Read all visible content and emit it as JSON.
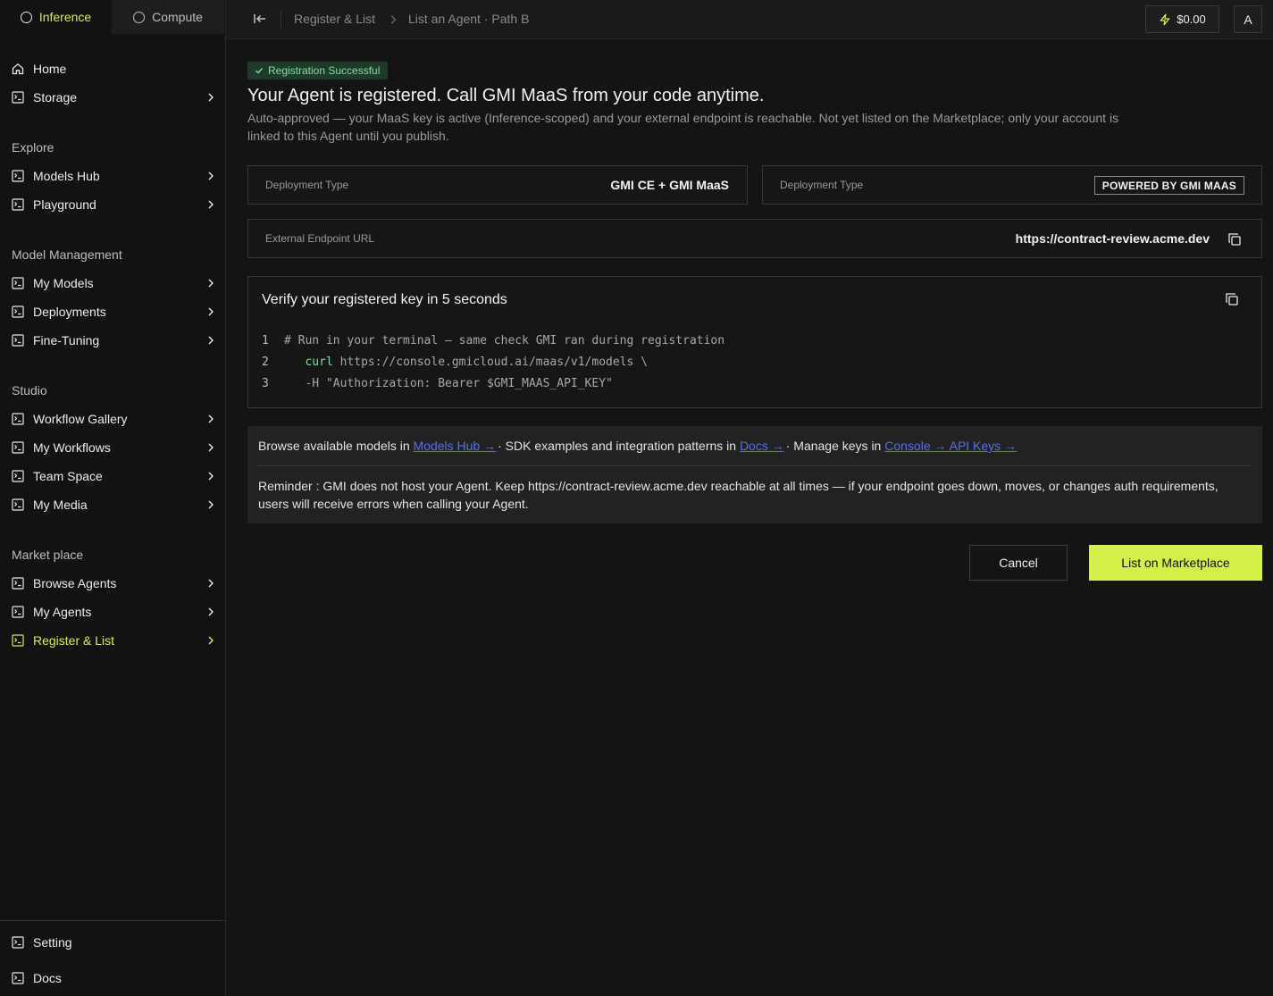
{
  "sidebar": {
    "mode_tabs": {
      "inference": "Inference",
      "compute": "Compute"
    },
    "home": "Home",
    "storage": "Storage",
    "sections": {
      "explore": "Explore",
      "model_management": "Model Management",
      "studio": "Studio",
      "marketplace": "Market place"
    },
    "items": {
      "models_hub": "Models Hub",
      "playground": "Playground",
      "my_models": "My Models",
      "deployments": "Deployments",
      "fine_tuning": "Fine-Tuning",
      "workflow_gallery": "Workflow Gallery",
      "my_workflows": "My Workflows",
      "team_space": "Team Space",
      "my_media": "My Media",
      "browse_agents": "Browse Agents",
      "my_agents": "My Agents",
      "register_list": "Register & List"
    },
    "setting": "Setting",
    "docs": "Docs",
    "accent_color": "#d4ef4a"
  },
  "topbar": {
    "breadcrumb": [
      "Register & List",
      "List an Agent · Path B"
    ],
    "balance": "$0.00",
    "avatar": "A"
  },
  "main": {
    "badge": "Registration Successful",
    "headline": "Your Agent is registered. Call GMI MaaS from your code anytime.",
    "subtext": "Auto-approved — your MaaS key is active (Inference-scoped) and your external endpoint is reachable. Not yet listed on the Marketplace; only your account is linked to this Agent until you publish.",
    "deployment_card_1": {
      "label": "Deployment Type",
      "value": "GMI CE + GMI MaaS"
    },
    "deployment_card_2": {
      "label": "Deployment Type",
      "tag": "POWERED BY GMI MAAS"
    },
    "endpoint_card": {
      "label": "External Endpoint URL",
      "value": "https://contract-review.acme.dev"
    },
    "verify": {
      "title": "Verify your registered key in 5 seconds",
      "lines": [
        {
          "n": "1",
          "text": "# Run in your terminal — same check GMI ran during registration"
        },
        {
          "n": "2",
          "keyword": "curl",
          "text": " https://console.gmicloud.ai/maas/v1/models \\"
        },
        {
          "n": "3",
          "text": "-H \"Authorization: Bearer $GMI_MAAS_API_KEY\""
        }
      ]
    },
    "info": {
      "browse_prefix": "Browse available models in ",
      "models_hub_link": "Models Hub →",
      "sdk_prefix": "· SDK examples and integration patterns in ",
      "docs_link": "Docs →",
      "manage_prefix": "· Manage keys in ",
      "console_link": "Console → API Keys →",
      "reminder": "Reminder : GMI does not host your Agent. Keep https://contract-review.acme.dev reachable at all times — if your endpoint goes down, moves, or changes auth requirements, users will receive errors when calling your Agent."
    },
    "buttons": {
      "cancel": "Cancel",
      "list": "List on Marketplace"
    }
  }
}
